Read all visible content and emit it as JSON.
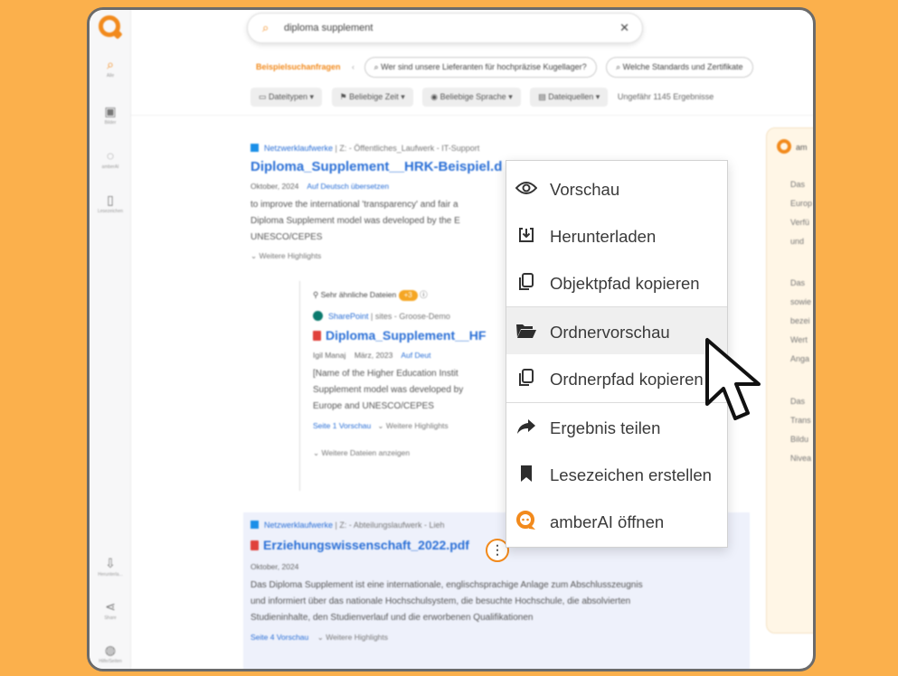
{
  "search": {
    "query": "diploma supplement"
  },
  "sidebar": {
    "items": [
      {
        "icon": "search-icon",
        "label": "Alle"
      },
      {
        "icon": "image-icon",
        "label": "Bilder"
      },
      {
        "icon": "chat-icon",
        "label": "amberAI"
      },
      {
        "icon": "bookmark-icon",
        "label": "Lesezeichen"
      },
      {
        "icon": "upload-icon",
        "label": "Herunterla..."
      },
      {
        "icon": "share-icon",
        "label": "Share"
      },
      {
        "icon": "help-icon",
        "label": "Hilfe/Seiten"
      }
    ]
  },
  "suggestions": {
    "label": "Beispielsuchanfragen",
    "chips": [
      "Wer sind unsere Lieferanten für hochpräzise Kugellager?",
      "Welche Standards und Zertifikate"
    ]
  },
  "filters": {
    "buttons": [
      "Dateitypen",
      "Beliebige Zeit",
      "Beliebige Sprache",
      "Dateiquellen"
    ],
    "result_count": "Ungefähr 1145 Ergebnisse"
  },
  "result1": {
    "source": "Netzwerklaufwerke",
    "path": "Z: - Öffentliches_Laufwerk - IT-Support",
    "title": "Diploma_Supplement__HRK-Beispiel.d",
    "date": "Oktober, 2024",
    "translate": "Auf Deutsch übersetzen",
    "snippet": [
      "to improve the international 'transparency' and fair a",
      "Diploma Supplement model was developed by the E",
      "UNESCO/CEPES"
    ],
    "more_highlights": "Weitere Highlights",
    "similar": {
      "label": "Sehr ähnliche Dateien",
      "count": "+3"
    },
    "nested": {
      "source": "SharePoint",
      "path": "sites - Groose-Demo",
      "title": "Diploma_Supplement__HF",
      "author": "Igil Manaj",
      "date": "März, 2023",
      "translate": "Auf Deut",
      "snippet": [
        "[Name of the Higher Education Instit",
        "Supplement model was developed by",
        "Europe and UNESCO/CEPES"
      ],
      "preview": "Seite 1 Vorschau",
      "more_highlights": "Weitere Highlights",
      "show_more": "Weitere Dateien anzeigen"
    }
  },
  "result2": {
    "source": "Netzwerklaufwerke",
    "path": "Z: - Abteilungslaufwerk - Lieh",
    "title": "Erziehungswissenschaft_2022.pdf",
    "date": "Oktober, 2024",
    "snippet": [
      "Das Diploma Supplement ist eine internationale, englischsprachige Anlage zum Abschlusszeugnis",
      "und informiert über das nationale Hochschulsystem, die besuchte Hochschule, die absolvierten",
      "Studieninhalte, den Studienverlauf und die erworbenen Qualifikationen"
    ],
    "preview": "Seite 4 Vorschau",
    "more_highlights": "Weitere Highlights"
  },
  "right_panel": {
    "title": "am",
    "lines": [
      "Das",
      "Europ",
      "Verfü",
      "und ",
      "Das",
      "sowie",
      "bezei",
      "Wert",
      "Anga",
      "Das",
      "Trans",
      "Bildu",
      "Nivea"
    ]
  },
  "menu": {
    "items": [
      {
        "icon": "eye-icon",
        "label": "Vorschau"
      },
      {
        "icon": "download-icon",
        "label": "Herunterladen"
      },
      {
        "icon": "copy-icon",
        "label": "Objektpfad kopieren"
      },
      {
        "icon": "folder-open-icon",
        "label": "Ordnervorschau"
      },
      {
        "icon": "copy-icon",
        "label": "Ordnerpfad kopieren"
      },
      {
        "icon": "share-arrow-icon",
        "label": "Ergebnis teilen"
      },
      {
        "icon": "bookmark-icon",
        "label": "Lesezeichen erstellen"
      },
      {
        "icon": "amber-logo-icon",
        "label": "amberAI öffnen"
      }
    ],
    "hovered": "Ordnervorschau"
  }
}
